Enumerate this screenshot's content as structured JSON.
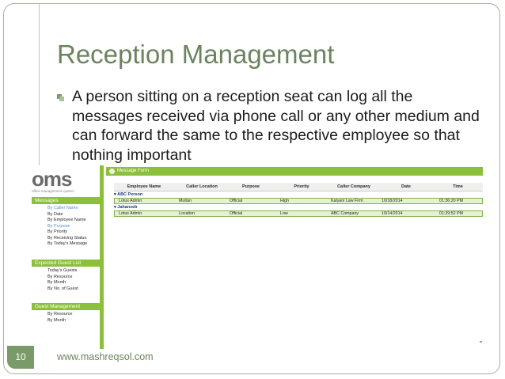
{
  "slide": {
    "title": "Reception Management",
    "bullet": "A person sitting on a reception seat can log all the messages received via phone call or any other medium and can forward the same to the respective employee so that nothing important",
    "slide_number": "10",
    "footer_url": "www.mashreqsol.com"
  },
  "app": {
    "logo": "oms",
    "logo_tagline": "office management system",
    "sidebar": {
      "messages": {
        "label": "Messages",
        "items": [
          "By Caller Name",
          "By Date",
          "By Employee Name",
          "By Purpose",
          "By Priority",
          "By Receiving Status",
          "By Today's Message"
        ]
      },
      "expected_guest": {
        "label": "Expected Guest List",
        "items": [
          "Today's Guests",
          "By Resource",
          "By Month",
          "By No. of Guest"
        ]
      },
      "guest_management": {
        "label": "Guest Management",
        "items": [
          "By Resource",
          "By Month"
        ]
      }
    },
    "form_title": "Message Form",
    "columns": [
      "Employee Name",
      "Caller Location",
      "Purpose",
      "Priority",
      "Caller Company",
      "Date",
      "Time"
    ],
    "groups": [
      {
        "name": "ABC Person",
        "row": [
          "Lotus Admin",
          "Multan",
          "Official",
          "High",
          "Kalyani Law Firm",
          "10/18/2014",
          "01:36:20 PM"
        ]
      },
      {
        "name": "Jahanzeb",
        "row": [
          "Lotus Admin",
          "Location",
          "Official",
          "Low",
          "ABC Company",
          "10/14/2014",
          "01:29:52 PM"
        ]
      }
    ]
  },
  "colors": {
    "accent_green": "#8cbf3a",
    "title_green": "#6b8460",
    "row_highlight": "#e3f3d2"
  }
}
